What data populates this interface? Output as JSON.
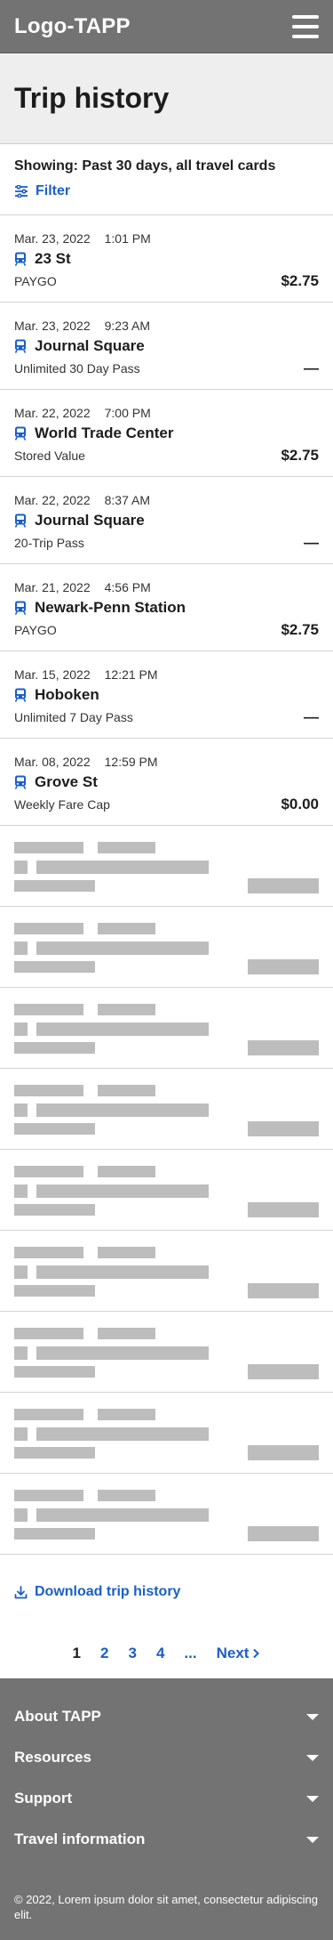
{
  "header": {
    "logo": "Logo-TAPP"
  },
  "page": {
    "title": "Trip history"
  },
  "filters": {
    "showing": "Showing: Past 30 days, all travel cards",
    "filter_label": "Filter"
  },
  "trips": [
    {
      "date": "Mar. 23, 2022",
      "time": "1:01 PM",
      "station": "23 St",
      "fare_type": "PAYGO",
      "fare": "$2.75"
    },
    {
      "date": "Mar. 23, 2022",
      "time": "9:23 AM",
      "station": "Journal Square",
      "fare_type": "Unlimited 30 Day Pass",
      "fare": "—"
    },
    {
      "date": "Mar. 22, 2022",
      "time": "7:00 PM",
      "station": "World Trade Center",
      "fare_type": "Stored Value",
      "fare": "$2.75"
    },
    {
      "date": "Mar. 22, 2022",
      "time": "8:37 AM",
      "station": "Journal Square",
      "fare_type": "20-Trip Pass",
      "fare": "—"
    },
    {
      "date": "Mar. 21, 2022",
      "time": "4:56 PM",
      "station": "Newark-Penn Station",
      "fare_type": "PAYGO",
      "fare": "$2.75"
    },
    {
      "date": "Mar. 15, 2022",
      "time": "12:21 PM",
      "station": "Hoboken",
      "fare_type": "Unlimited 7 Day Pass",
      "fare": "—"
    },
    {
      "date": "Mar. 08, 2022",
      "time": "12:59 PM",
      "station": "Grove St",
      "fare_type": "Weekly Fare Cap",
      "fare": "$0.00"
    }
  ],
  "download": {
    "label": "Download trip history"
  },
  "pagination": {
    "pages": [
      "1",
      "2",
      "3",
      "4"
    ],
    "ellipsis": "...",
    "next": "Next"
  },
  "footer": {
    "sections": [
      "About TAPP",
      "Resources",
      "Support",
      "Travel information"
    ],
    "copyright": "© 2022, Lorem ipsum dolor sit amet, consectetur adipiscing elit."
  },
  "colors": {
    "header_bg": "#737373",
    "link": "#1a5fc7",
    "skeleton": "#bdbdbd",
    "title_band": "#eeeeee"
  },
  "icons": {
    "menu": "hamburger-icon",
    "filter": "sliders-icon",
    "transit": "train-icon",
    "download": "download-icon",
    "next": "chevron-right-icon",
    "expand": "caret-down-icon"
  }
}
